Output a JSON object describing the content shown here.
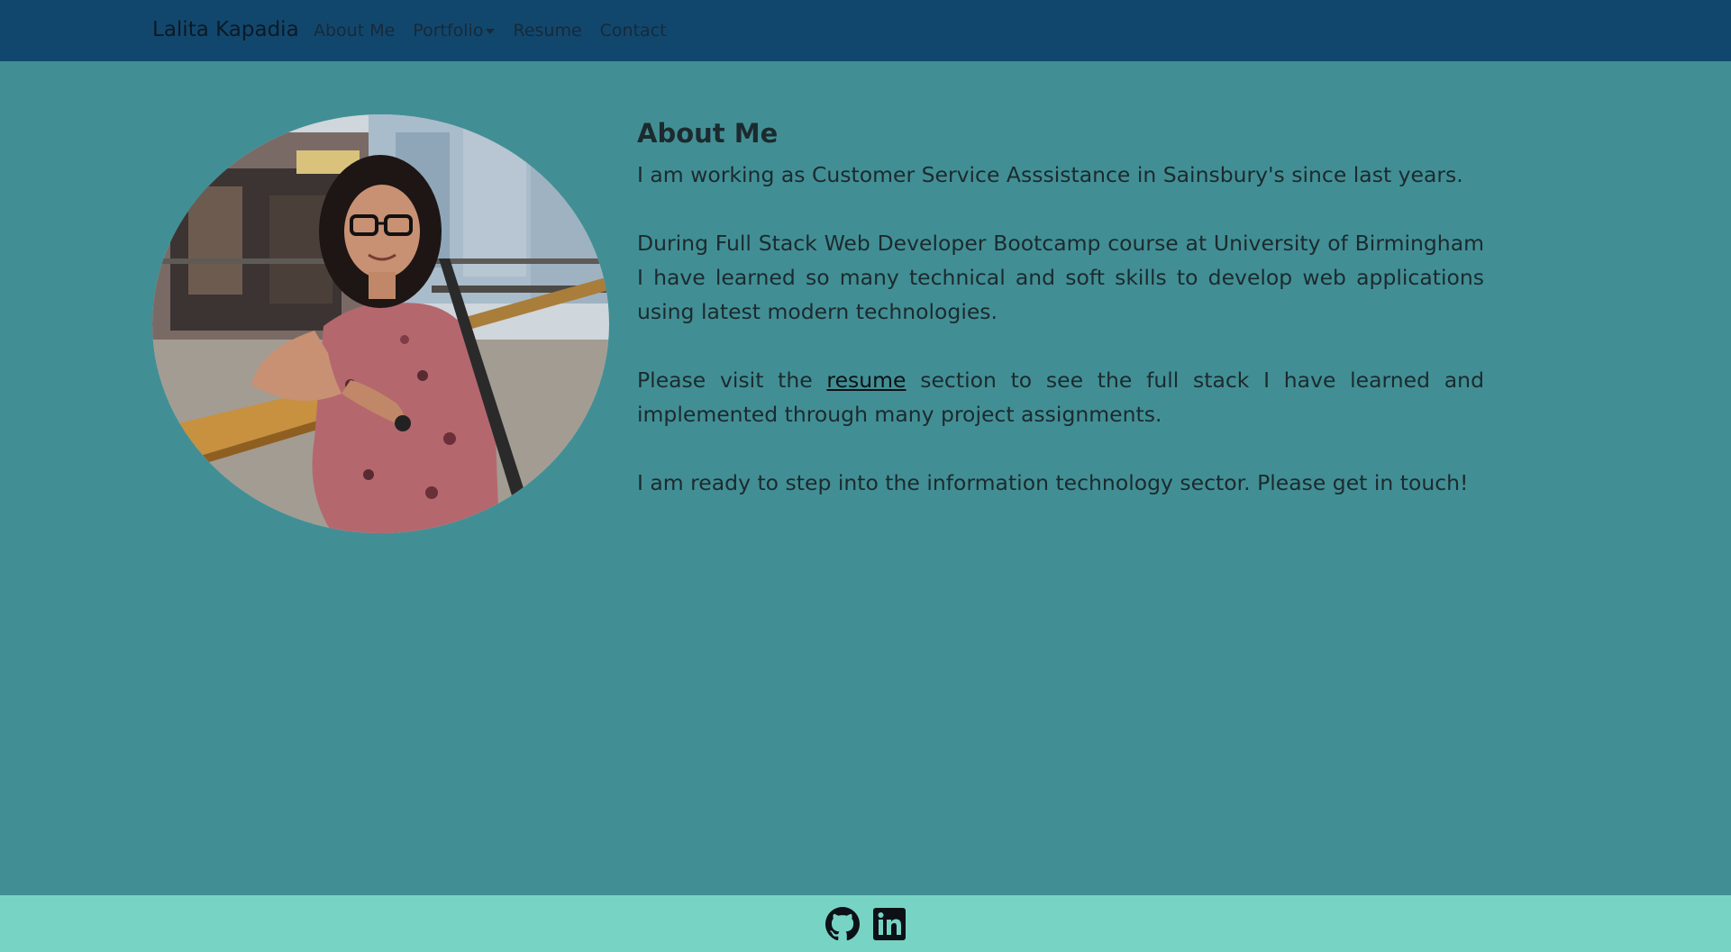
{
  "nav": {
    "brand": "Lalita Kapadia",
    "items": [
      {
        "label": "About Me"
      },
      {
        "label": "Portfolio",
        "dropdown": true
      },
      {
        "label": "Resume"
      },
      {
        "label": "Contact"
      }
    ]
  },
  "about": {
    "heading": "About Me",
    "p1": "I am working as Customer Service Asssistance in Sainsbury's since last years.",
    "p2": "During Full Stack Web Developer Bootcamp course at University of Birmingham I have learned so many technical and soft skills to develop web applications using latest modern technologies.",
    "p3_before": "Please visit the ",
    "p3_link": "resume",
    "p3_after": " section to see the full stack I have learned and implemented through many project assignments.",
    "p4": "I am ready to step into the information technology sector. Please get in touch!"
  },
  "photo": {
    "icon": "profile-photo"
  },
  "footer": {
    "icons": [
      "github-icon",
      "linkedin-icon"
    ]
  },
  "colors": {
    "navbar": "#12476d",
    "background": "#418f95",
    "footer": "#77d4c5"
  }
}
